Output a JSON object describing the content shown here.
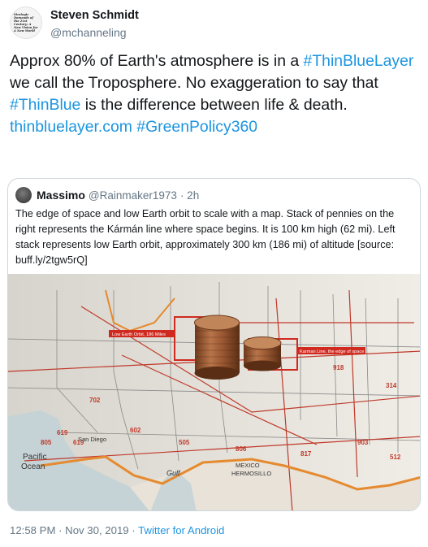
{
  "author": {
    "avatar_text": "Strategic Demands of the 21st Century: A New Vision for A New World",
    "display_name": "Steven Schmidt",
    "handle": "@mchanneling"
  },
  "tweet": {
    "text_1": "Approx 80% of Earth's atmosphere is in a ",
    "hashtag_1": "#ThinBlueLayer",
    "text_2": " we call the Troposphere. No exaggeration to say that ",
    "hashtag_2": "#ThinBlue",
    "text_3": " is the difference between life & death. ",
    "link": "thinbluelayer.com",
    "hashtag_3": "#GreenPolicy360"
  },
  "quote": {
    "display_name": "Massimo",
    "handle": "@Rainmaker1973",
    "time": "· 2h",
    "text": "The edge of space and low Earth orbit to scale with a map. Stack of pennies on the right represents the Kármán line where space begins. It is 100 km high (62 mi). Left stack represents low Earth orbit, approximately 300 km (186 mi) of altitude [source: buff.ly/2tgw5rQ]",
    "image": {
      "label_left": "Low Earth Orbit, 186 Miles",
      "label_right": "Karman Line, the edge of space",
      "ocean_label_1": "Pacific",
      "ocean_label_2": "Ocean",
      "city_1": "San Diego",
      "city_2": "MEXICO",
      "city_3": "HERMOSILLO",
      "gulf": "Gulf"
    }
  },
  "footer": {
    "time": "12:58 PM · Nov 30, 2019 · ",
    "app": "Twitter for Android"
  }
}
